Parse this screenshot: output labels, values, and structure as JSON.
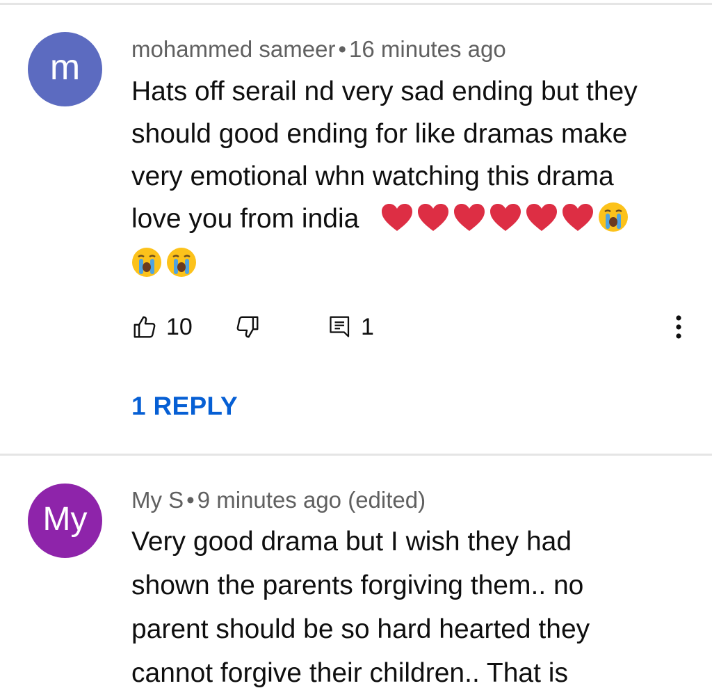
{
  "comments": [
    {
      "avatar_letter": "m",
      "avatar_color": "#5c6bc0",
      "author": "mohammed sameer",
      "separator": "•",
      "time": "16 minutes ago",
      "lines": [
        "Hats off serail nd very sad ending but they",
        "should good ending for like dramas make",
        "very emotional whn watching this drama",
        "love you from india"
      ],
      "emojis_line4": [
        "red-heart",
        "red-heart",
        "red-heart",
        "red-heart",
        "red-heart",
        "red-heart",
        "crying-face"
      ],
      "emojis_line5": [
        "crying-face",
        "crying-face"
      ],
      "like_count": "10",
      "reply_count": "1",
      "replies_link": "1 REPLY"
    },
    {
      "avatar_letter": "My",
      "avatar_color": "#8e24aa",
      "author": "My S",
      "separator": "•",
      "time": "9 minutes ago (edited)",
      "lines": [
        "Very good drama but I wish they had",
        "shown the parents forgiving them.. no",
        "parent should be so hard hearted they",
        "cannot forgive their children.. That is"
      ]
    }
  ],
  "icons": {
    "like": "thumbs-up-icon",
    "dislike": "thumbs-down-icon",
    "reply": "comment-icon",
    "more": "more-vert-icon",
    "accent_color": "#065fd4"
  }
}
